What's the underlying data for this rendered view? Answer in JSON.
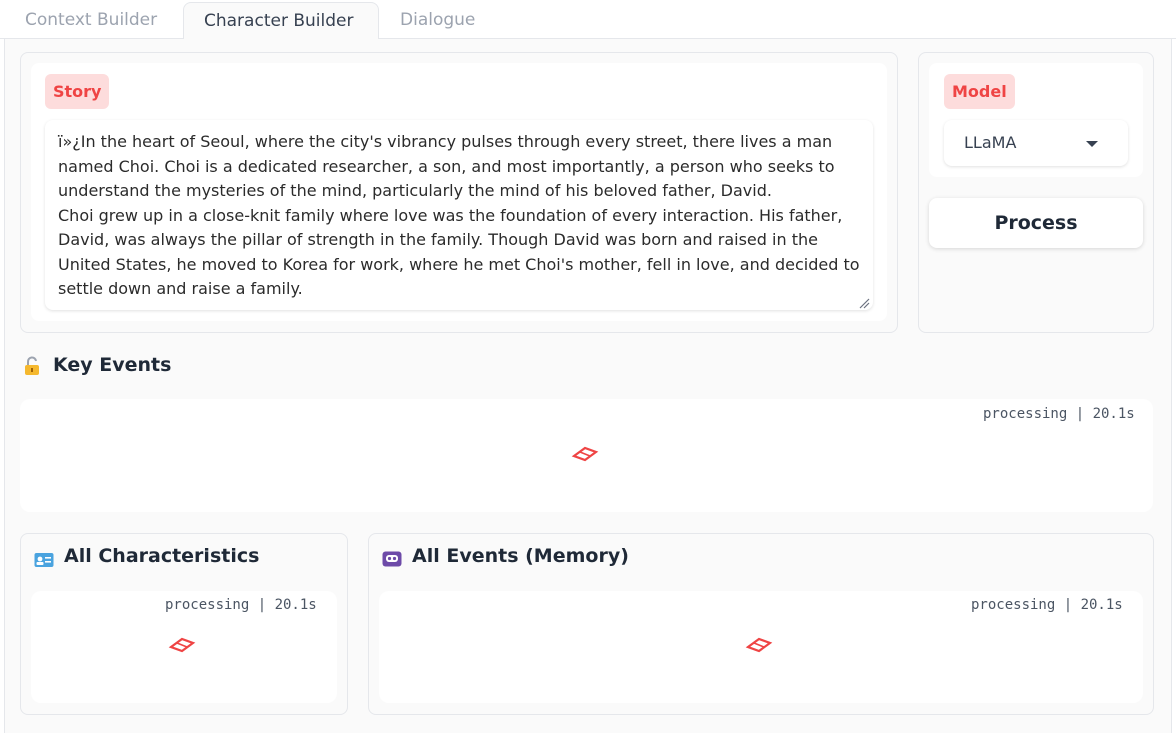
{
  "tabs": [
    {
      "label": "Context Builder"
    },
    {
      "label": "Character Builder"
    },
    {
      "label": "Dialogue"
    }
  ],
  "story": {
    "label": "Story",
    "text": "ï»¿In the heart of Seoul, where the city's vibrancy pulses through every street, there lives a man named Choi. Choi is a dedicated researcher, a son, and most importantly, a person who seeks to understand the mysteries of the mind, particularly the mind of his beloved father, David.\nChoi grew up in a close-knit family where love was the foundation of every interaction. His father, David, was always the pillar of strength in the family. Though David was born and raised in the United States, he moved to Korea for work, where he met Choi's mother, fell in love, and decided to settle down and raise a family."
  },
  "model": {
    "label": "Model",
    "selected": "LLaMA"
  },
  "process_button": "Process",
  "key_events": {
    "title": "Key Events",
    "status": "processing | 20.1s"
  },
  "characteristics": {
    "title": "All Characteristics",
    "status": "processing | 20.1s"
  },
  "memory": {
    "title": "All Events (Memory)",
    "status": "processing | 20.1s"
  },
  "colors": {
    "accent": "#ef4444",
    "badge_bg": "#fddcdc"
  }
}
